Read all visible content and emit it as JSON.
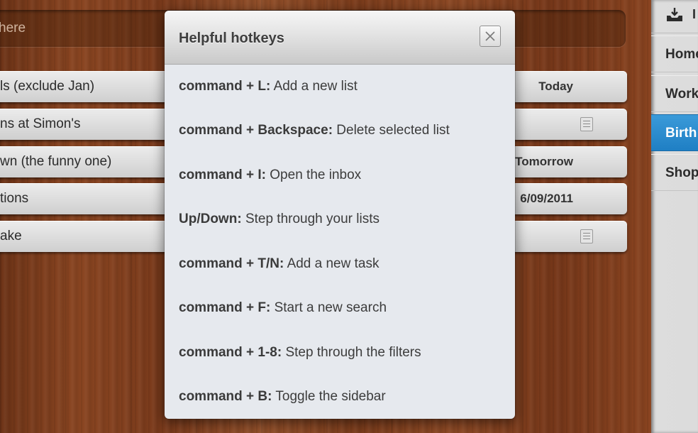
{
  "task_input": {
    "placeholder": "here"
  },
  "tasks": [
    {
      "title": "ls (exclude Jan)",
      "date": "Today",
      "has_note": false
    },
    {
      "title": "ns at Simon's",
      "date": "",
      "has_note": true
    },
    {
      "title": "wn (the funny one)",
      "date": "Tomorrow",
      "has_note": false
    },
    {
      "title": "tions",
      "date": "6/09/2011",
      "has_note": false
    },
    {
      "title": "ake",
      "date": "",
      "has_note": true
    }
  ],
  "sidebar": {
    "inbox_label": "I",
    "items": [
      {
        "label": "Home",
        "active": false
      },
      {
        "label": "Work",
        "active": false
      },
      {
        "label": "Birth",
        "active": true
      },
      {
        "label": "Shop",
        "active": false
      }
    ]
  },
  "modal": {
    "title": "Helpful hotkeys",
    "hotkeys": [
      {
        "key": "command + L:",
        "description": "Add a new list"
      },
      {
        "key": "command + Backspace:",
        "description": "Delete selected list"
      },
      {
        "key": "command + I:",
        "description": "Open the inbox"
      },
      {
        "key": "Up/Down:",
        "description": "Step through your lists"
      },
      {
        "key": "command + T/N:",
        "description": "Add a new task"
      },
      {
        "key": "command + F:",
        "description": "Start a new search"
      },
      {
        "key": "command + 1-8:",
        "description": "Step through the filters"
      },
      {
        "key": "command + B:",
        "description": "Toggle the sidebar"
      }
    ]
  },
  "icons": {
    "close": "close-icon",
    "inbox": "inbox-icon",
    "note": "note-icon"
  },
  "colors": {
    "active_accent": "#2a8bd0",
    "wood": "#8a4521"
  }
}
